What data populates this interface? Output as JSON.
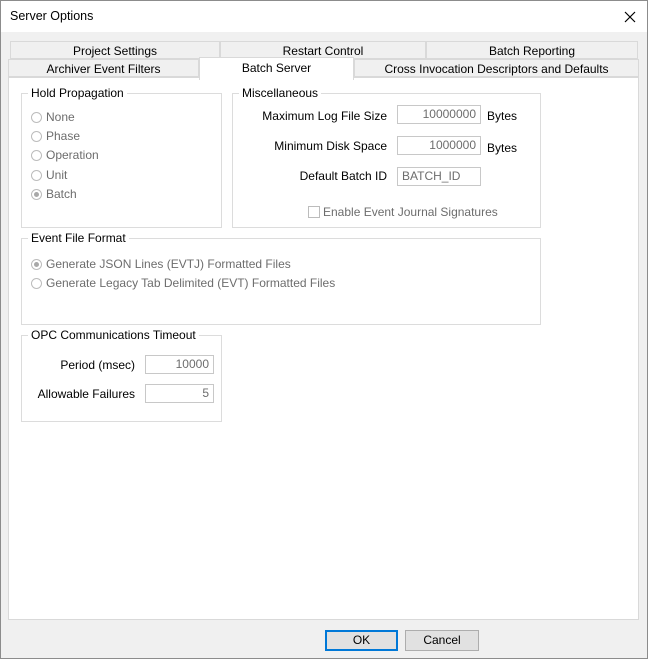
{
  "window": {
    "title": "Server Options"
  },
  "tabs_row1": [
    "Project Settings",
    "Restart Control",
    "Batch Reporting"
  ],
  "tabs_row2": [
    "Archiver Event Filters",
    "Batch Server",
    "Cross Invocation Descriptors and Defaults"
  ],
  "active_tab": "Batch Server",
  "hold_propagation": {
    "title": "Hold Propagation",
    "options": [
      "None",
      "Phase",
      "Operation",
      "Unit",
      "Batch"
    ],
    "selected": "Batch"
  },
  "misc": {
    "title": "Miscellaneous",
    "max_log_label": "Maximum Log File Size",
    "max_log_value": "10000000",
    "max_log_unit": "Bytes",
    "min_disk_label": "Minimum Disk Space",
    "min_disk_value": "1000000",
    "min_disk_unit": "Bytes",
    "batch_id_label": "Default Batch ID",
    "batch_id_value": "BATCH_ID",
    "journal_label": "Enable Event Journal Signatures",
    "journal_checked": false
  },
  "event_file": {
    "title": "Event File Format",
    "options": [
      "Generate JSON Lines (EVTJ) Formatted Files",
      "Generate Legacy Tab Delimited (EVT) Formatted Files"
    ],
    "selected": "Generate JSON Lines (EVTJ) Formatted Files"
  },
  "opc": {
    "title": "OPC Communications Timeout",
    "period_label": "Period (msec)",
    "period_value": "10000",
    "failures_label": "Allowable Failures",
    "failures_value": "5"
  },
  "buttons": {
    "ok": "OK",
    "cancel": "Cancel"
  }
}
